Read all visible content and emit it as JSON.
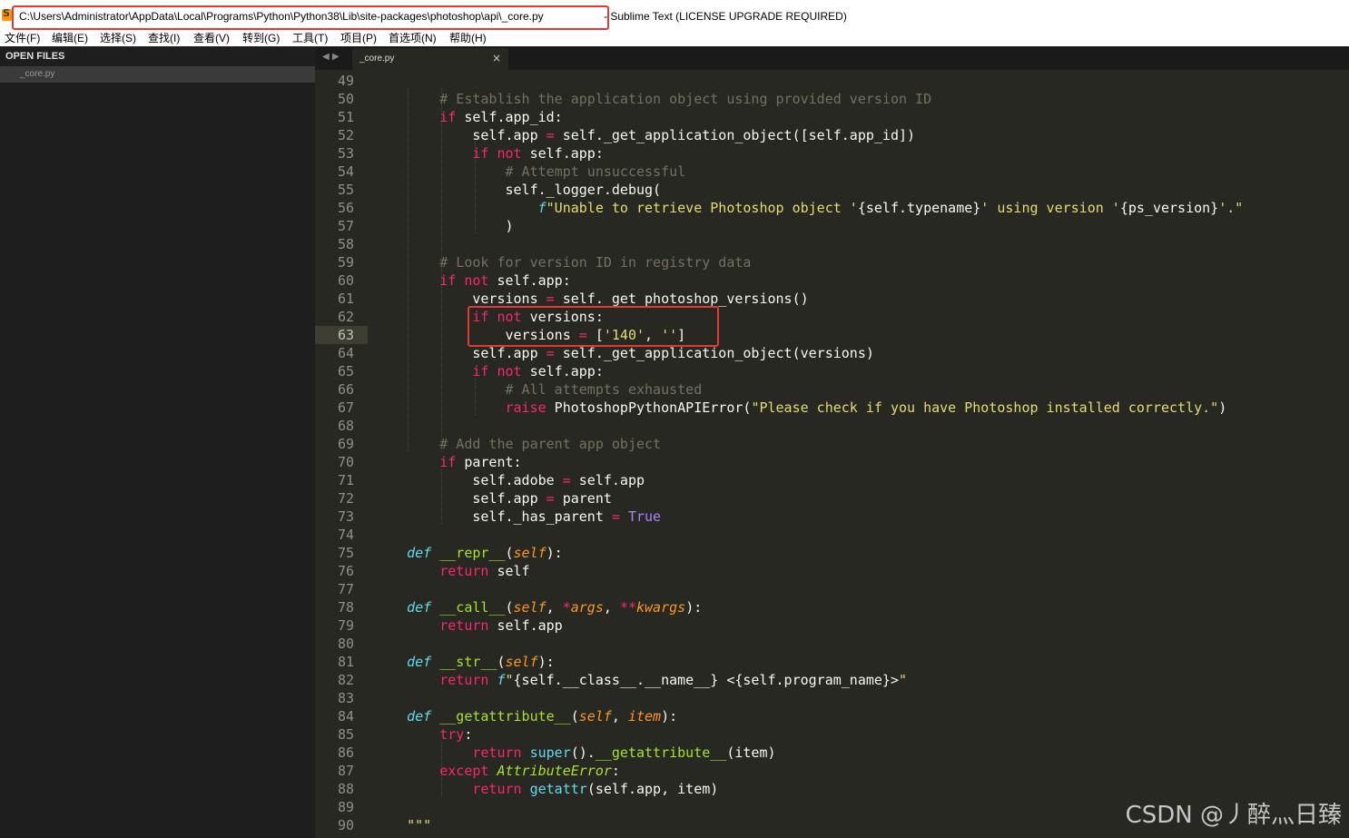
{
  "window": {
    "path": "C:\\Users\\Administrator\\AppData\\Local\\Programs\\Python\\Python38\\Lib\\site-packages\\photoshop\\api\\_core.py",
    "suffix": "- Sublime Text (LICENSE UPGRADE REQUIRED)"
  },
  "menu": [
    "文件(F)",
    "编辑(E)",
    "选择(S)",
    "查找(I)",
    "查看(V)",
    "转到(G)",
    "工具(T)",
    "项目(P)",
    "首选项(N)",
    "帮助(H)"
  ],
  "sidebar": {
    "header": "OPEN FILES",
    "files": [
      "_core.py"
    ]
  },
  "tabs": [
    {
      "label": "_core.py",
      "close": "×"
    }
  ],
  "tab_nav": "◀ ▶",
  "editor": {
    "first_line": 49,
    "last_line": 90,
    "current_line": 63
  },
  "watermark": "CSDN @丿醉灬日臻",
  "colors": {
    "background": "#272822",
    "keyword": "#f92672",
    "string": "#e6db74",
    "comment": "#75715e",
    "function": "#a6e22e",
    "highlight_box": "#e53935"
  }
}
